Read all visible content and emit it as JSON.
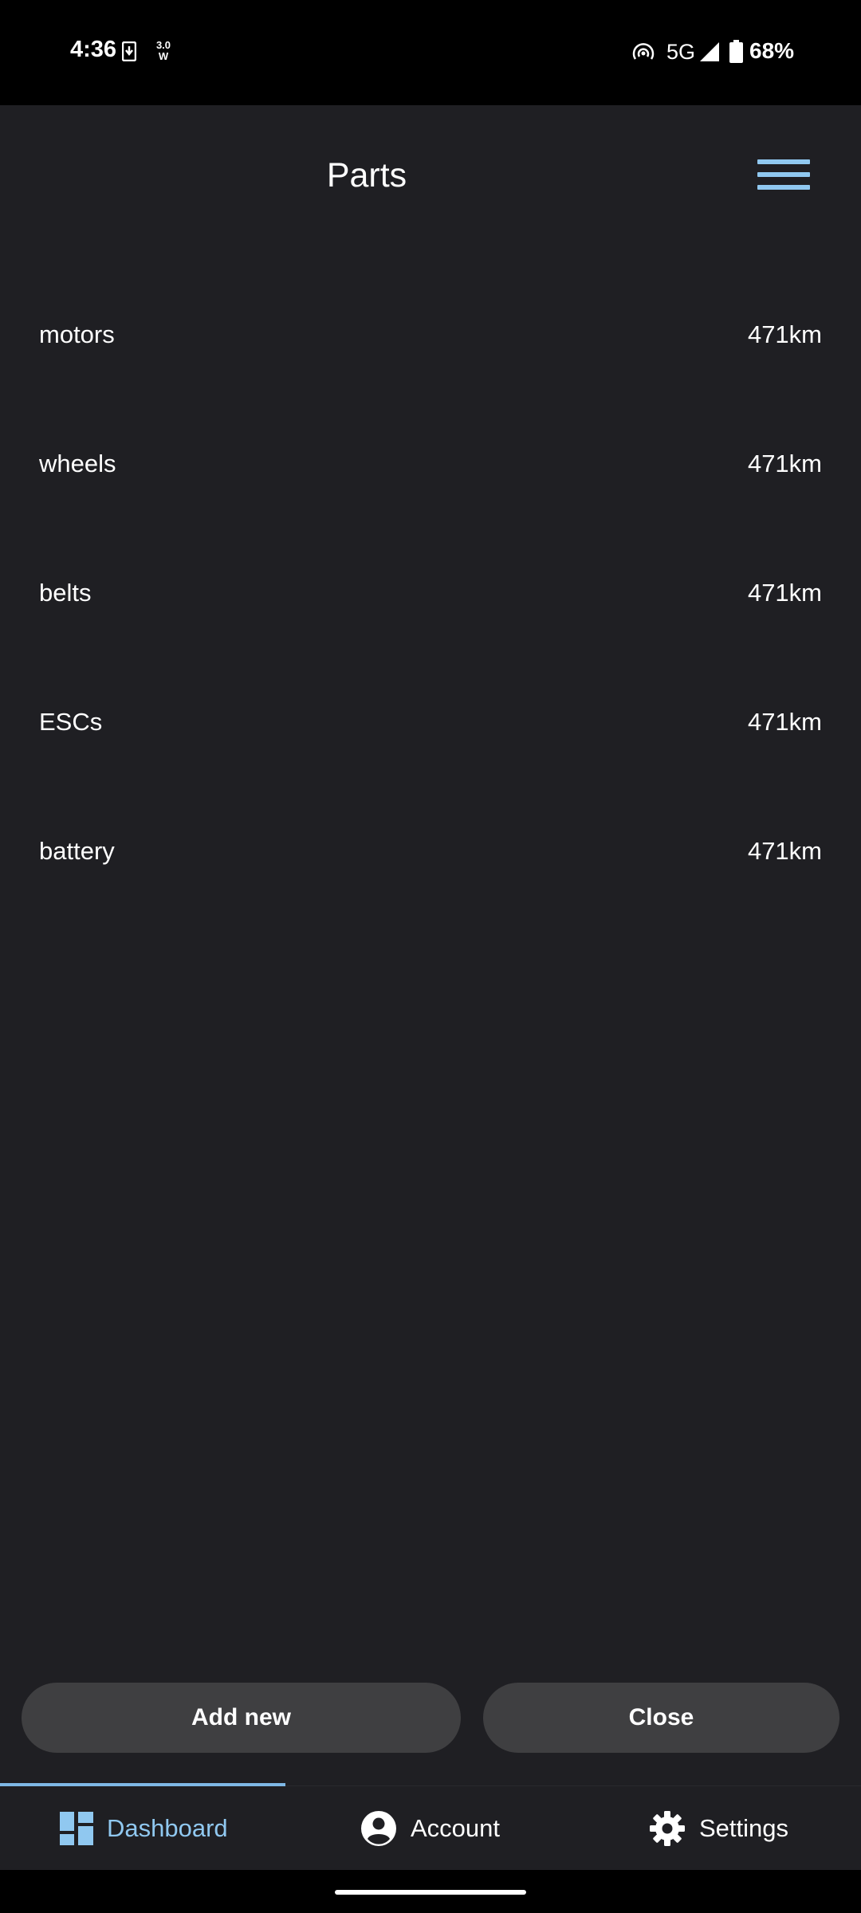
{
  "status_bar": {
    "time": "4:36",
    "power_label": "3.0\nW",
    "network": "5G",
    "battery": "68%"
  },
  "header": {
    "title": "Parts"
  },
  "parts": [
    {
      "name": "motors",
      "distance": "471km"
    },
    {
      "name": "wheels",
      "distance": "471km"
    },
    {
      "name": "belts",
      "distance": "471km"
    },
    {
      "name": "ESCs",
      "distance": "471km"
    },
    {
      "name": "battery",
      "distance": "471km"
    }
  ],
  "actions": {
    "add_label": "Add new",
    "close_label": "Close"
  },
  "nav": {
    "dashboard": "Dashboard",
    "account": "Account",
    "settings": "Settings",
    "active": "dashboard"
  },
  "colors": {
    "background": "#1f1f23",
    "accent": "#90c8f0",
    "button": "#3f3f41"
  },
  "icons": {
    "menu": "hamburger-menu-icon",
    "dashboard": "dashboard-icon",
    "account": "account-circle-icon",
    "settings": "gear-icon"
  }
}
